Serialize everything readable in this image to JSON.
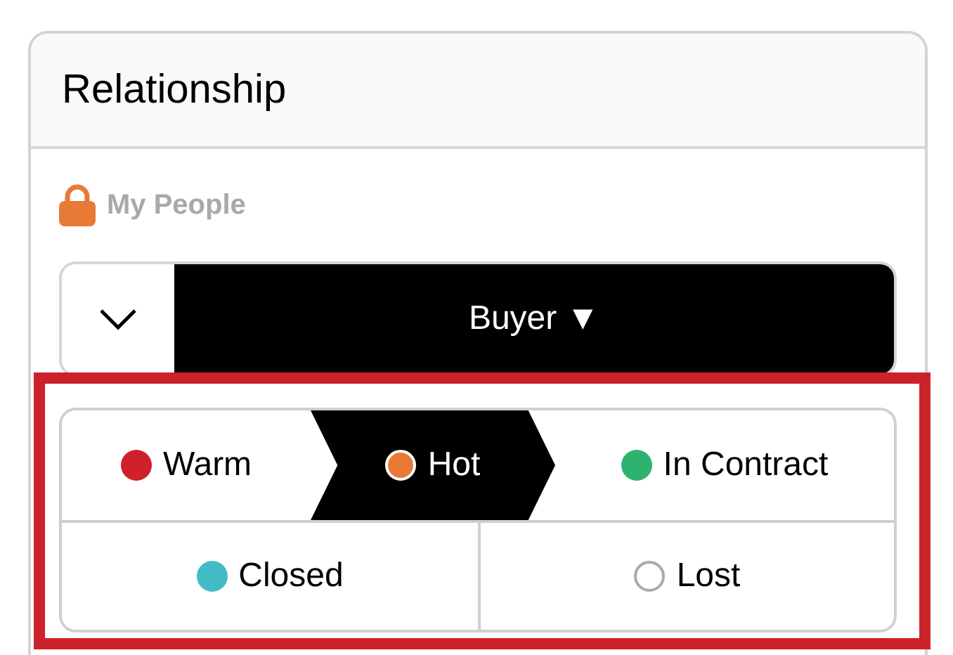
{
  "card": {
    "title": "Relationship"
  },
  "access": {
    "label": "My People"
  },
  "type_select": {
    "value": "Buyer ▼"
  },
  "stages": [
    {
      "label": "Warm",
      "color": "#d0202a",
      "selected": false
    },
    {
      "label": "Hot",
      "color": "#e87a35",
      "selected": true
    },
    {
      "label": "In Contract",
      "color": "#2eb36e",
      "selected": false
    },
    {
      "label": "Closed",
      "color": "#42bcc4",
      "selected": false
    },
    {
      "label": "Lost",
      "color": "#ffffff",
      "selected": false
    }
  ]
}
